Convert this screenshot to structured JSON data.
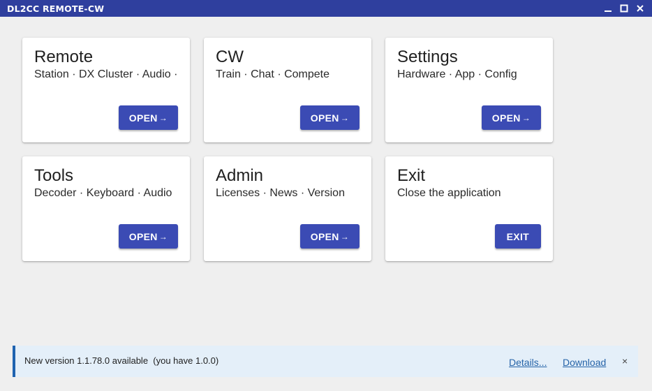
{
  "window": {
    "title": "DL2CC REMOTE-CW",
    "titlebar_color": "#2f3f9e",
    "controls": [
      "minimize-icon",
      "maximize-icon",
      "close-icon"
    ]
  },
  "cards": [
    {
      "title": "Remote",
      "subtitle": "Station · DX Cluster · Audio ·",
      "button": "OPEN",
      "arrow": "→"
    },
    {
      "title": "CW",
      "subtitle": "Train · Chat · Compete",
      "button": "OPEN",
      "arrow": "→"
    },
    {
      "title": "Settings",
      "subtitle": "Hardware · App · Config",
      "button": "OPEN",
      "arrow": "→"
    },
    {
      "title": "Tools",
      "subtitle": "Decoder · Keyboard · Audio",
      "button": "OPEN",
      "arrow": "→"
    },
    {
      "title": "Admin",
      "subtitle": "Licenses · News · Version",
      "button": "OPEN",
      "arrow": "→"
    },
    {
      "title": "Exit",
      "subtitle": "Close the application",
      "button": "EXIT"
    }
  ],
  "accent_color": "#3b4bb4",
  "update_banner": {
    "message": "New version 1.1.78.0 available  (you have 1.0.0)",
    "details_link": "Details...",
    "download_link": "Download",
    "close": "×",
    "background": "#e4eff9",
    "stripe_color": "#1f63b0"
  }
}
